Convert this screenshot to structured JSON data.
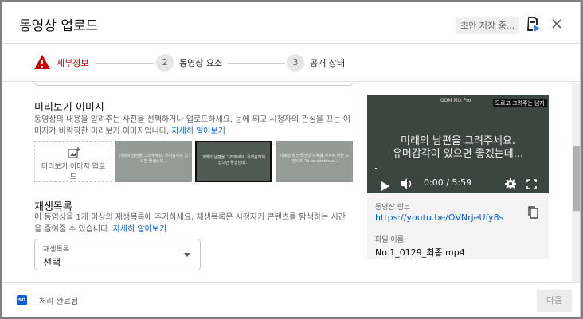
{
  "header": {
    "title": "동영상 업로드",
    "draft_status": "초안 저장 중...",
    "close_icon": "close-icon",
    "feedback_icon": "feedback-icon"
  },
  "stepper": {
    "steps": [
      {
        "label": "세부정보",
        "state": "error",
        "icon": "warning-icon"
      },
      {
        "number": "2",
        "label": "동영상 요소"
      },
      {
        "number": "3",
        "label": "공개 상태"
      }
    ],
    "error_color": "#cc0000"
  },
  "thumbnail": {
    "title": "미리보기 이미지",
    "description": "동영상의 내용을 알려주는 사진을 선택하거나 업로드하세요. 눈에 띄고 시청자의 관심을 끄는 이미지가 바람직한 미리보기 이미지입니다.",
    "learn_more": "자세히 알아보기",
    "upload_label": "미리보기 이미지 업로드",
    "options": [
      {
        "text": "미래의 남편을 그려주세요. 유머감각이 있으면 좋겠는데...",
        "selected": false
      },
      {
        "text": "미래의 남편을 그려주세요. 유머감각이 있으면 좋겠는데...",
        "selected": true
      },
      {
        "text": "대화전에 한국인의 지혜를 거쳐야 하는 고민이야. To be continue...",
        "selected": false
      }
    ]
  },
  "playlist": {
    "title": "재생목록",
    "description": "이 동영상을 1개 이상의 재생목록에 추가하세요. 재생목록은 시청자가 콘텐츠를 탐색하는 시간을 줄여줄 수 있습니다.",
    "learn_more": "자세히 알아보기",
    "select_label": "재생목록",
    "select_value": "선택"
  },
  "video": {
    "logo_text": "GOM Mix Pro",
    "tag": "모르고 그려주는 남자",
    "line1": "미래의 남편을 그려주세요.",
    "line2": "유머감각이 있으면 좋겠는데...",
    "time": "0:00 / 5:59",
    "progress": 0
  },
  "meta": {
    "link_label": "동영상 링크",
    "link": "https://youtu.be/OVNrjeUfy8s",
    "file_label": "파일 이름",
    "file_name": "No.1_0129_최종.mp4"
  },
  "footer": {
    "badge": "SD",
    "status": "처리 완료됨",
    "next_label": "다음"
  }
}
